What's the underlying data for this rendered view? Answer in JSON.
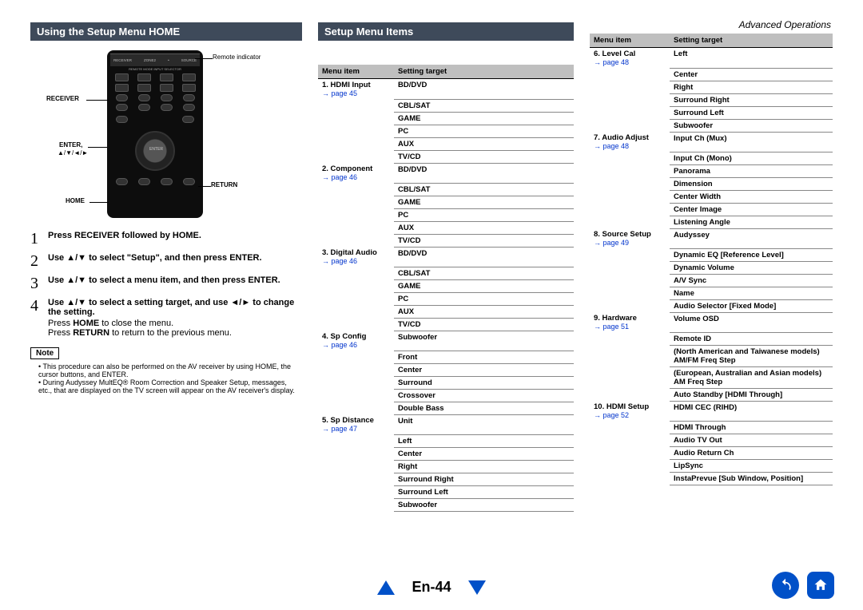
{
  "section_header": "Advanced Operations",
  "heading_left": "Using the Setup Menu HOME",
  "heading_mid": "Setup Menu Items",
  "remote": {
    "indicator_label": "Remote indicator",
    "labels": {
      "receiver": "RECEIVER",
      "enter": "ENTER,",
      "arrows": "▲/▼/◄/►",
      "home": "HOME",
      "return": "RETURN"
    }
  },
  "steps": [
    {
      "num": "1",
      "text": "Press RECEIVER followed by HOME."
    },
    {
      "num": "2",
      "text": "Use ▲/▼ to select \"Setup\", and then press ENTER."
    },
    {
      "num": "3",
      "text": "Use ▲/▼ to select a menu item, and then press ENTER."
    },
    {
      "num": "4",
      "text": "Use ▲/▼ to select a setting target, and use ◄/► to change the setting."
    }
  ],
  "after_steps": {
    "line1_a": "Press ",
    "line1_b": "HOME",
    "line1_c": " to close the menu.",
    "line2_a": "Press ",
    "line2_b": "RETURN",
    "line2_c": " to return to the previous menu."
  },
  "note_label": "Note",
  "notes": [
    "This procedure can also be performed on the AV receiver by using HOME, the cursor buttons, and ENTER.",
    "During Audyssey MultEQ® Room Correction and Speaker Setup, messages, etc., that are displayed on the TV screen will appear on the AV receiver's display."
  ],
  "table_header": {
    "col1": "Menu item",
    "col2": "Setting target"
  },
  "page_link_prefix": "→ page ",
  "table_left": [
    {
      "title": "1. HDMI Input",
      "page": "45",
      "targets": [
        "BD/DVD",
        "CBL/SAT",
        "GAME",
        "PC",
        "AUX",
        "TV/CD"
      ]
    },
    {
      "title": "2. Component",
      "page": "46",
      "targets": [
        "BD/DVD",
        "CBL/SAT",
        "GAME",
        "PC",
        "AUX",
        "TV/CD"
      ]
    },
    {
      "title": "3. Digital Audio",
      "page": "46",
      "targets": [
        "BD/DVD",
        "CBL/SAT",
        "GAME",
        "PC",
        "AUX",
        "TV/CD"
      ]
    },
    {
      "title": "4. Sp Config",
      "page": "46",
      "targets": [
        "Subwoofer",
        "Front",
        "Center",
        "Surround",
        "Crossover",
        "Double Bass"
      ]
    },
    {
      "title": "5. Sp Distance",
      "page": "47",
      "targets": [
        "Unit",
        "Left",
        "Center",
        "Right",
        "Surround Right",
        "Surround Left",
        "Subwoofer"
      ]
    }
  ],
  "table_right": [
    {
      "title": "6. Level Cal",
      "page": "48",
      "targets": [
        "Left",
        "Center",
        "Right",
        "Surround Right",
        "Surround Left",
        "Subwoofer"
      ]
    },
    {
      "title": "7. Audio Adjust",
      "page": "48",
      "targets": [
        "Input Ch (Mux)",
        "Input Ch (Mono)",
        "Panorama",
        "Dimension",
        "Center Width",
        "Center Image",
        "Listening Angle"
      ]
    },
    {
      "title": "8. Source Setup",
      "page": "49",
      "targets": [
        "Audyssey",
        "Dynamic EQ [Reference Level]",
        "Dynamic Volume",
        "A/V Sync",
        "Name",
        "Audio Selector [Fixed Mode]"
      ]
    },
    {
      "title": "9. Hardware",
      "page": "51",
      "targets": [
        "Volume OSD",
        "Remote ID",
        "(North American and Taiwanese models)\nAM/FM Freq Step",
        "(European, Australian and Asian models)\nAM Freq Step",
        "Auto Standby [HDMI Through]"
      ]
    },
    {
      "title": "10. HDMI Setup",
      "page": "52",
      "targets": [
        "HDMI CEC (RIHD)",
        "HDMI Through",
        "Audio TV Out",
        "Audio Return Ch",
        "LipSync",
        "InstaPrevue [Sub Window, Position]"
      ]
    }
  ],
  "page_number": "En-44"
}
